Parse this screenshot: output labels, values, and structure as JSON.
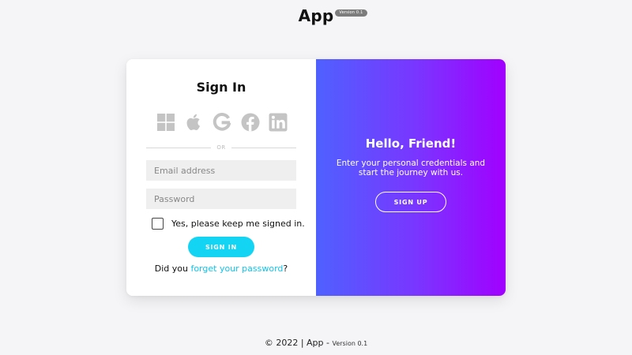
{
  "header": {
    "brand": "App",
    "version_badge": "Version 0.1"
  },
  "sign_in": {
    "title": "Sign In",
    "social_icons": [
      "windows-icon",
      "apple-icon",
      "google-icon",
      "facebook-icon",
      "linkedin-icon"
    ],
    "divider_text": "OR",
    "email_placeholder": "Email address",
    "password_placeholder": "Password",
    "remember_label": "Yes, please keep me signed in.",
    "remember_checked": false,
    "button_label": "SIGN IN",
    "forgot_prefix": "Did you ",
    "forgot_link": "forget your password",
    "forgot_suffix": "?"
  },
  "sign_up": {
    "title": "Hello, Friend!",
    "text": "Enter your personal credentials and start the journey with us.",
    "button_label": "SIGN UP"
  },
  "footer": {
    "copyright": "© 2022 | App - ",
    "version": "Version 0.1"
  },
  "colors": {
    "accent": "#14d4f4",
    "gradient_start": "#4f61ff",
    "gradient_end": "#a100ff",
    "social_icon": "#c4c4c4",
    "background": "#f5f5f7"
  }
}
